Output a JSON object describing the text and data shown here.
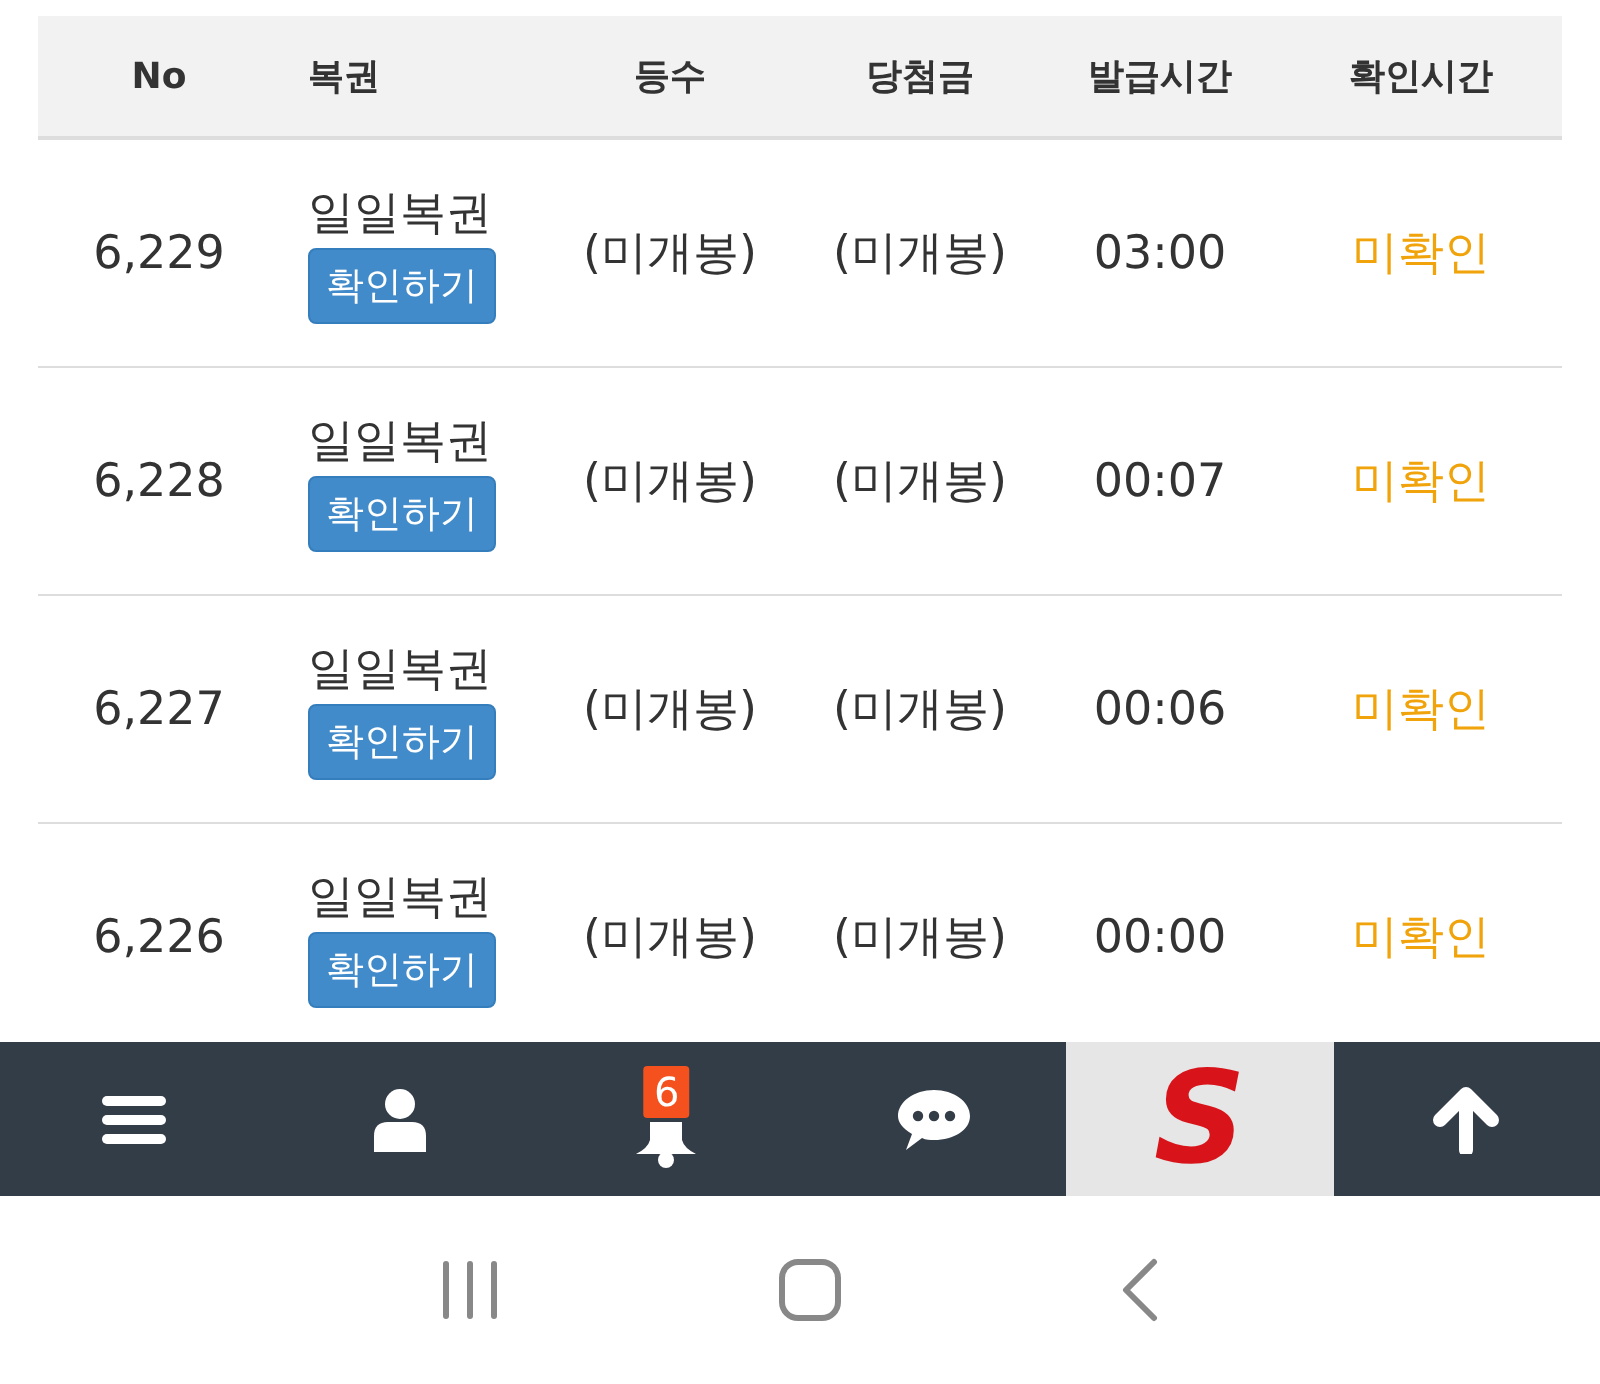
{
  "table": {
    "columns": [
      "No",
      "복권",
      "등수",
      "당첨금",
      "발급시간",
      "확인시간"
    ],
    "rows": [
      {
        "no": "6,229",
        "ticket": "일일복권",
        "button": "확인하기",
        "rank": "(미개봉)",
        "prize": "(미개봉)",
        "issued": "03:00",
        "checked": "미확인"
      },
      {
        "no": "6,228",
        "ticket": "일일복권",
        "button": "확인하기",
        "rank": "(미개봉)",
        "prize": "(미개봉)",
        "issued": "00:07",
        "checked": "미확인"
      },
      {
        "no": "6,227",
        "ticket": "일일복권",
        "button": "확인하기",
        "rank": "(미개봉)",
        "prize": "(미개봉)",
        "issued": "00:06",
        "checked": "미확인"
      },
      {
        "no": "6,226",
        "ticket": "일일복권",
        "button": "확인하기",
        "rank": "(미개봉)",
        "prize": "(미개봉)",
        "issued": "00:00",
        "checked": "미확인"
      }
    ]
  },
  "bottom_bar": {
    "items": [
      {
        "kind": "menu"
      },
      {
        "kind": "user"
      },
      {
        "kind": "bell",
        "badge": "6"
      },
      {
        "kind": "chat"
      },
      {
        "kind": "logo",
        "text": "S"
      },
      {
        "kind": "top"
      }
    ]
  }
}
